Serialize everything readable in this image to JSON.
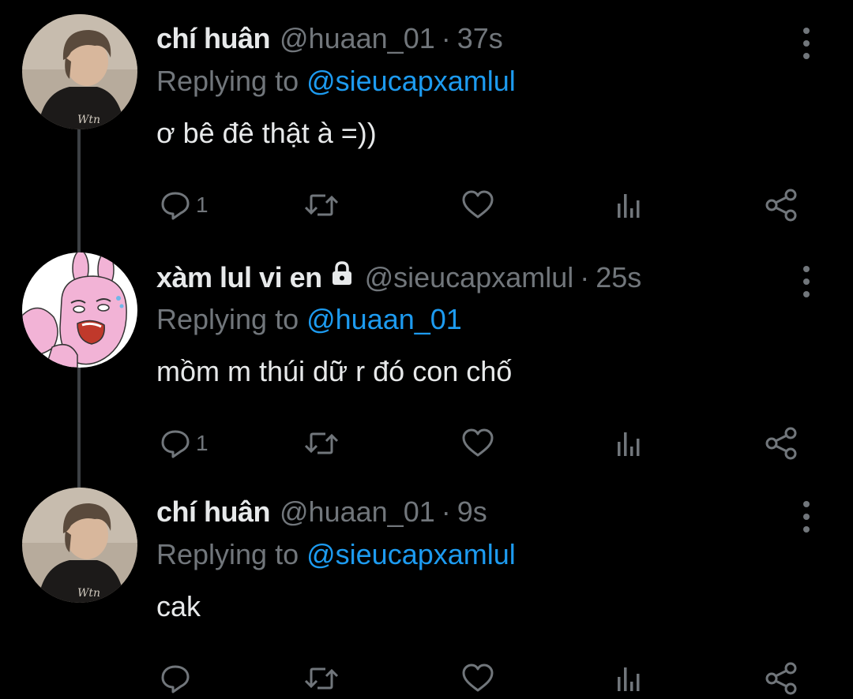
{
  "colors": {
    "background": "#000000",
    "text_primary": "#e7e9ea",
    "text_secondary": "#71767b",
    "mention": "#1d9bf0",
    "thread_line": "#3d4145"
  },
  "icons": {
    "reply": "speech-bubble",
    "retweet": "retweet-arrows",
    "like": "heart-outline",
    "stats": "bar-chart",
    "share": "share-nodes",
    "more": "vertical-dots",
    "lock": "padlock"
  },
  "tweets": [
    {
      "name": "chí huân",
      "handle": "@huaan_01",
      "separator": "·",
      "time": "37s",
      "replying_prefix": "Replying to ",
      "replying_to": "@sieucapxamlul",
      "text": "ơ bê đê thật à =))",
      "reply_count": "1",
      "avatar": "boy-photo",
      "locked": false
    },
    {
      "name": "xàm lul vi en",
      "handle": "@sieucapxamlul",
      "separator": "·",
      "time": "25s",
      "replying_prefix": "Replying to ",
      "replying_to": "@huaan_01",
      "text": "mồm m thúi dữ r đó con chố",
      "reply_count": "1",
      "avatar": "pink-bunny-cartoon",
      "locked": true
    },
    {
      "name": "chí huân",
      "handle": "@huaan_01",
      "separator": "·",
      "time": "9s",
      "replying_prefix": "Replying to ",
      "replying_to": "@sieucapxamlul",
      "text": "cak",
      "reply_count": "",
      "avatar": "boy-photo",
      "locked": false
    }
  ]
}
